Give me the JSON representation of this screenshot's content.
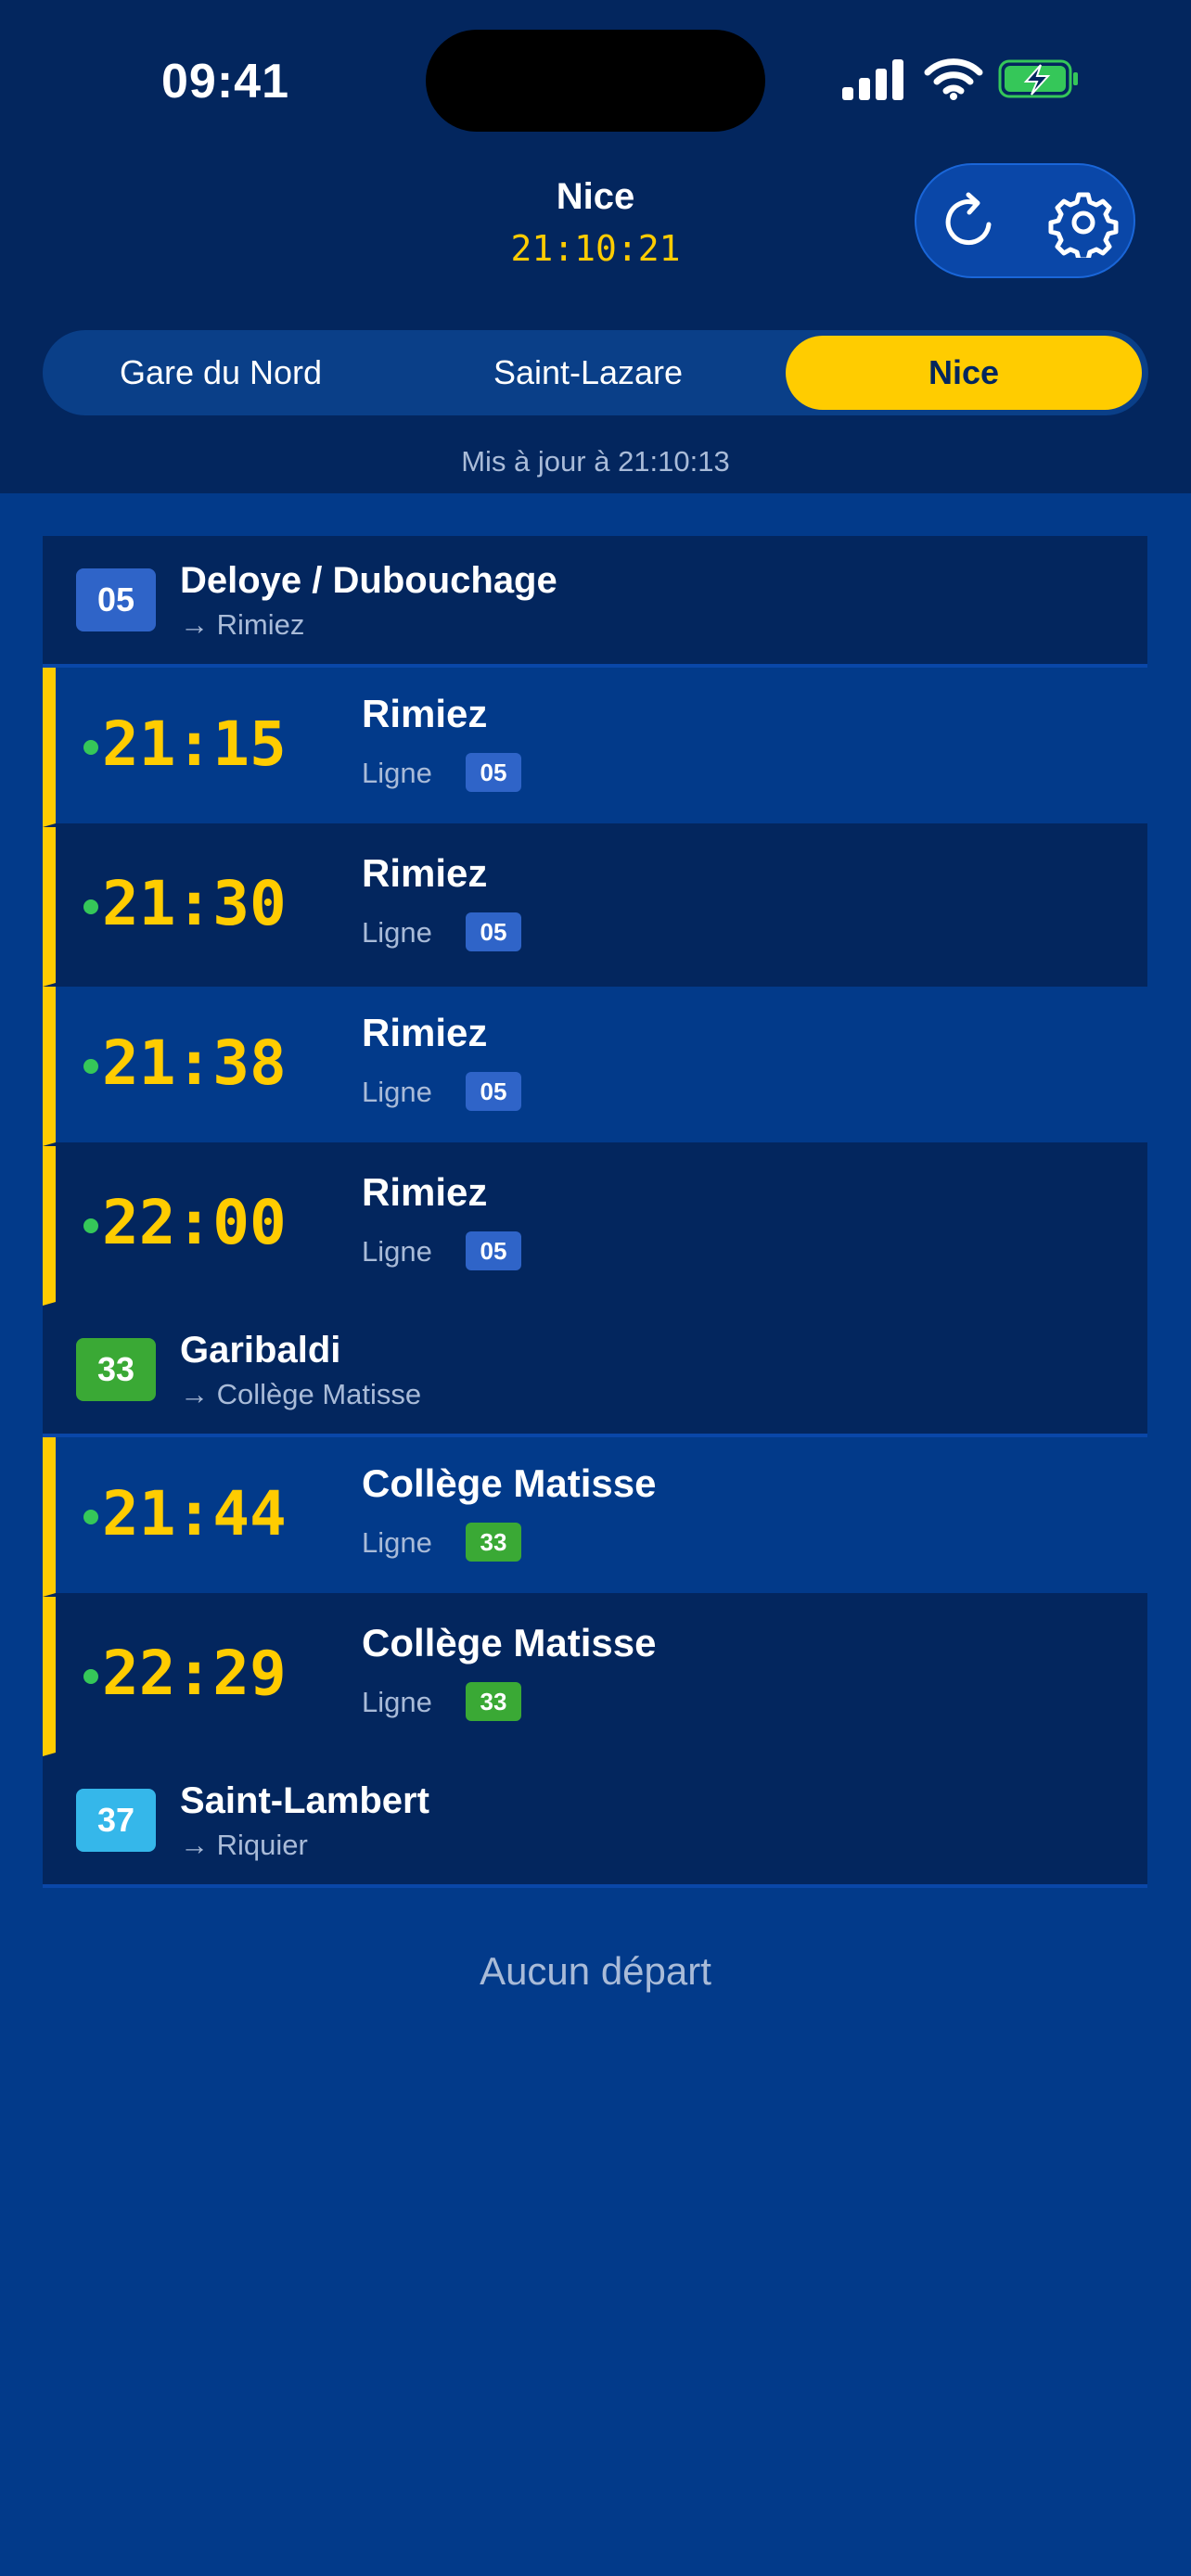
{
  "status_bar": {
    "time": "09:41"
  },
  "header": {
    "title": "Nice",
    "clock": "21:10:21"
  },
  "tabs": [
    {
      "label": "Gare du Nord",
      "active": false
    },
    {
      "label": "Saint-Lazare",
      "active": false
    },
    {
      "label": "Nice",
      "active": true
    }
  ],
  "updated": "Mis à jour à 21:10:13",
  "line_label": "Ligne",
  "colors": {
    "line05": "#2f64c8",
    "line33": "#3aa935",
    "line37": "#35b7ea",
    "accent": "#ffcc00"
  },
  "stops": [
    {
      "line": "05",
      "name": "Deloye / Dubouchage",
      "direction": "→ Rimiez",
      "departures": [
        {
          "time": "21:15",
          "dest": "Rimiez"
        },
        {
          "time": "21:30",
          "dest": "Rimiez"
        },
        {
          "time": "21:38",
          "dest": "Rimiez"
        },
        {
          "time": "22:00",
          "dest": "Rimiez"
        }
      ]
    },
    {
      "line": "33",
      "name": "Garibaldi",
      "direction": "→ Collège Matisse",
      "departures": [
        {
          "time": "21:44",
          "dest": "Collège Matisse"
        },
        {
          "time": "22:29",
          "dest": "Collège Matisse"
        }
      ]
    },
    {
      "line": "37",
      "name": "Saint-Lambert",
      "direction": "→ Riquier",
      "departures": []
    }
  ],
  "empty_text": "Aucun départ"
}
